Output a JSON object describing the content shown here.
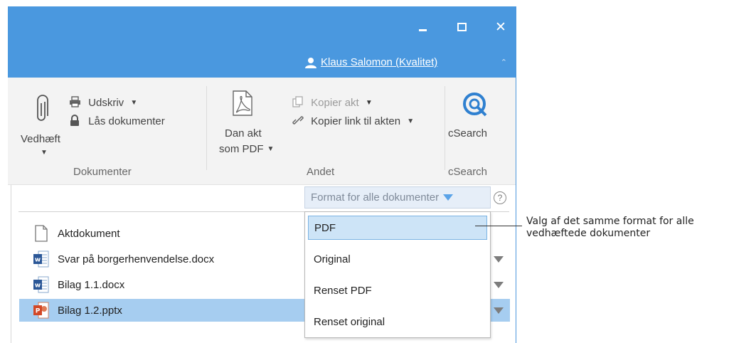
{
  "window": {
    "minimize_icon": "minimize-icon",
    "maximize_icon": "maximize-icon",
    "close_glyph": "✕"
  },
  "user": {
    "name": "Klaus Salomon (Kvalitet)",
    "collapse_glyph": "⌃"
  },
  "ribbon": {
    "groups": {
      "dokumenter": {
        "label": "Dokumenter",
        "attach_label": "Vedhæft",
        "print_label": "Udskriv",
        "lock_label": "Lås dokumenter"
      },
      "andet": {
        "label": "Andet",
        "pdf_label_1": "Dan akt",
        "pdf_label_2": "som PDF",
        "copy_akt_label": "Kopier akt",
        "copy_link_label": "Kopier link til akten"
      },
      "csearch": {
        "label": "cSearch",
        "button_label": "cSearch"
      }
    }
  },
  "content": {
    "format_all_label": "Format for alle dokumenter",
    "help_glyph": "?",
    "rows": [
      {
        "name": "Aktdokument",
        "icon": "document-icon"
      },
      {
        "name": "Svar på borgerhenvendelse.docx",
        "icon": "word-icon"
      },
      {
        "name": "Bilag 1.1.docx",
        "icon": "word-icon"
      },
      {
        "name": "Bilag 1.2.pptx",
        "icon": "powerpoint-icon",
        "selected": true
      }
    ],
    "format_options": [
      "PDF",
      "Original",
      "Renset PDF",
      "Renset original"
    ],
    "selected_option": "PDF"
  },
  "callout": {
    "line1": "Valg af det samme format for alle",
    "line2": "vedhæftede dokumenter"
  },
  "colors": {
    "titlebar": "#4a98df",
    "selection": "#a6cdf0",
    "accent": "#5aa3e8"
  }
}
